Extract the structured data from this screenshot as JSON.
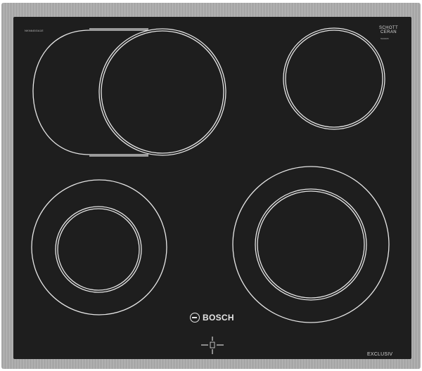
{
  "appliance": {
    "type": "ceramic hob",
    "model_number": "NKN645GA1E",
    "glass_brand": "SCHOTT CERAN",
    "glass_brand_line1": "SCHOTT",
    "glass_brand_line2": "CERAN",
    "glass_sub": "5930005",
    "brand": "BOSCH",
    "series": "EXCLUSIV"
  },
  "colors": {
    "frame": "#a9a9a9",
    "glass": "#1e1e1e",
    "markings": "#e6e6e6"
  },
  "cooking_zones": [
    {
      "name": "front-left",
      "rings": 2
    },
    {
      "name": "rear-left-extended",
      "rings": 2
    },
    {
      "name": "rear-right",
      "rings": 2
    },
    {
      "name": "front-right",
      "rings": 2
    }
  ]
}
